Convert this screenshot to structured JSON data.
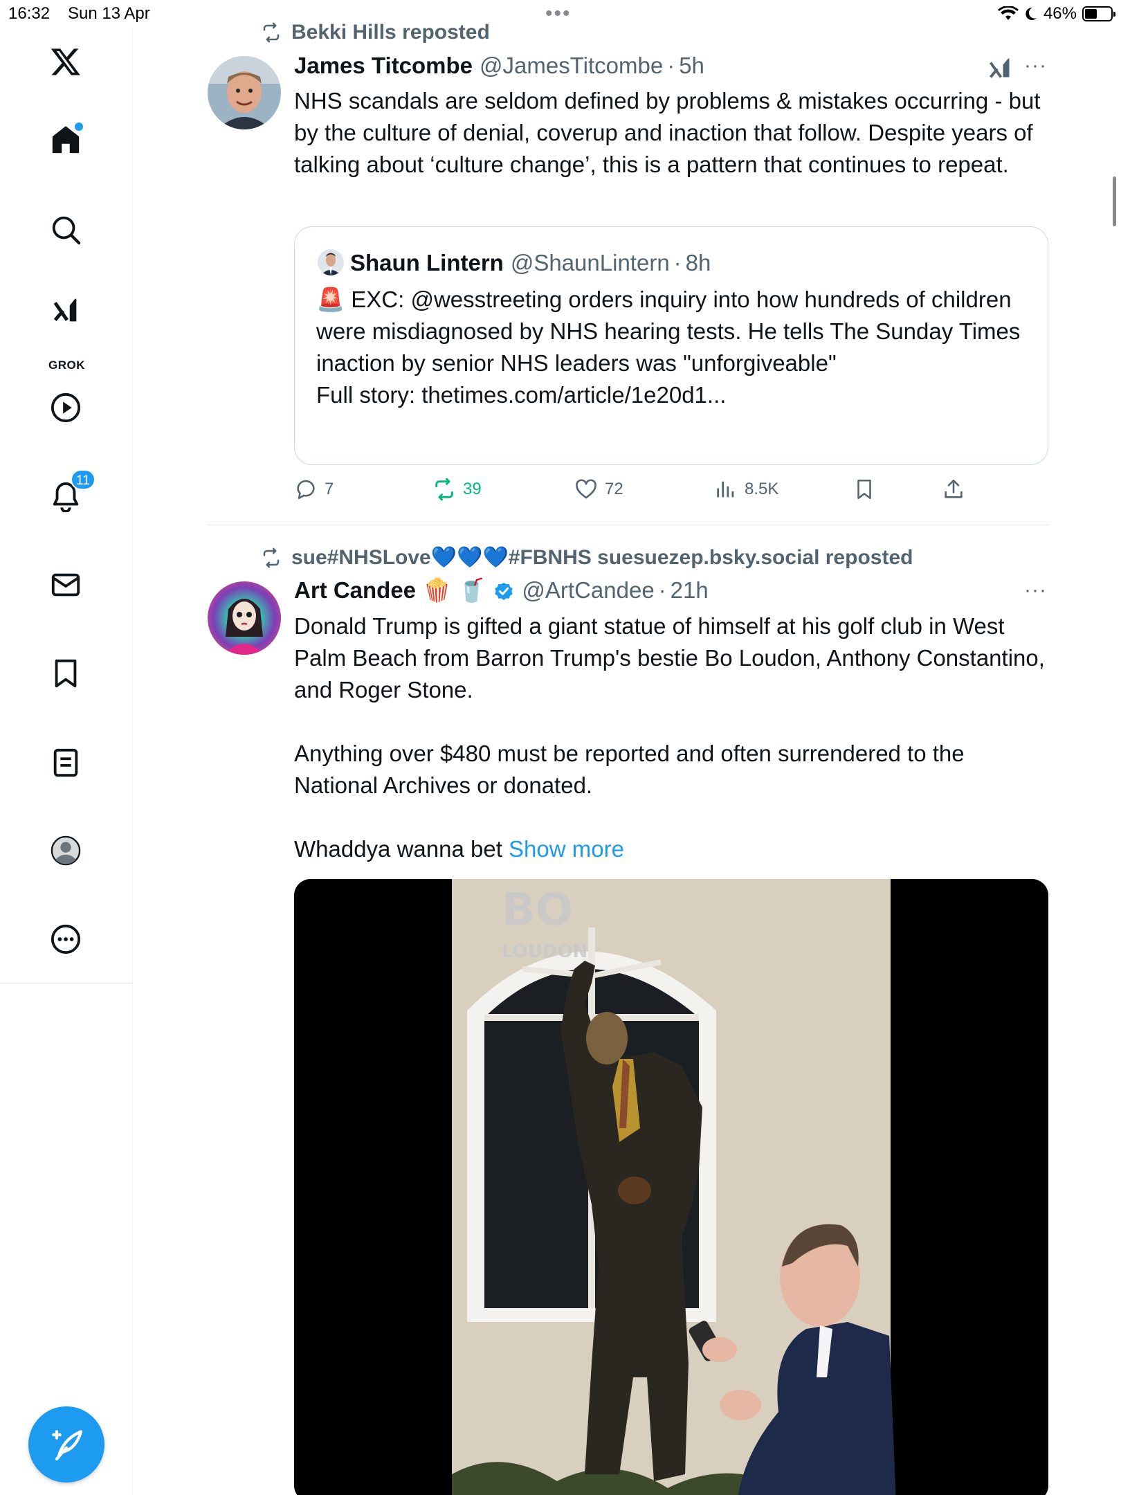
{
  "status_bar": {
    "time": "16:32",
    "date": "Sun 13 Apr",
    "battery": "46%",
    "battery_level": 0.46
  },
  "sidebar": {
    "grok_label": "GROK",
    "notifications_badge": "11",
    "items": [
      {
        "icon": "x-logo-icon"
      },
      {
        "icon": "home-icon",
        "active": true,
        "has_dot": true
      },
      {
        "icon": "search-icon"
      },
      {
        "icon": "grok-icon"
      },
      {
        "icon": "play-icon"
      },
      {
        "icon": "bell-icon"
      },
      {
        "icon": "mail-icon"
      },
      {
        "icon": "bookmark-icon"
      },
      {
        "icon": "list-icon"
      },
      {
        "icon": "profile-icon"
      },
      {
        "icon": "more-icon"
      }
    ],
    "compose_icon": "compose-icon"
  },
  "accent_color": "#1d9bf0",
  "repost_color": "#00ba7c",
  "tweets": [
    {
      "repost_label": "Bekki Hills reposted",
      "name": "James Titcombe",
      "handle": "@JamesTitcombe",
      "time": "5h",
      "text": "NHS scandals are seldom defined by problems & mistakes occurring - but by the culture of denial, coverup and inaction that follow. Despite years of talking about ‘culture change’, this is a pattern that continues to repeat.",
      "quote": {
        "name": "Shaun Lintern",
        "handle": "@ShaunLintern",
        "time": "8h",
        "text": "🚨 EXC: @wesstreeting orders inquiry into how hundreds of children were misdiagnosed by NHS hearing tests. He tells The Sunday Times inaction by senior NHS leaders was \"unforgiveable\"",
        "link": "Full story: thetimes.com/article/1e20d1..."
      },
      "stats": {
        "replies": "7",
        "reposts": "39",
        "likes": "72",
        "views": "8.5K"
      }
    },
    {
      "repost_label": "sue#NHSLove💙💙💙#FBNHS suesuezep.bsky.social reposted",
      "name": "Art Candee",
      "name_emoji": "🍿 🥤",
      "verified": true,
      "handle": "@ArtCandee",
      "time": "21h",
      "paragraph1": "Donald Trump is gifted a giant statue of himself at his golf club in West Palm Beach from Barron Trump's bestie Bo Loudon, Anthony Constantino, and Roger Stone.",
      "paragraph2": "Anything over $480 must be reported and often surrendered to the National Archives or donated.",
      "paragraph3": "Whaddya wanna bet",
      "show_more": "Show more",
      "media": {
        "watermark_big": "BO",
        "watermark_small": "LOUDON"
      }
    }
  ]
}
